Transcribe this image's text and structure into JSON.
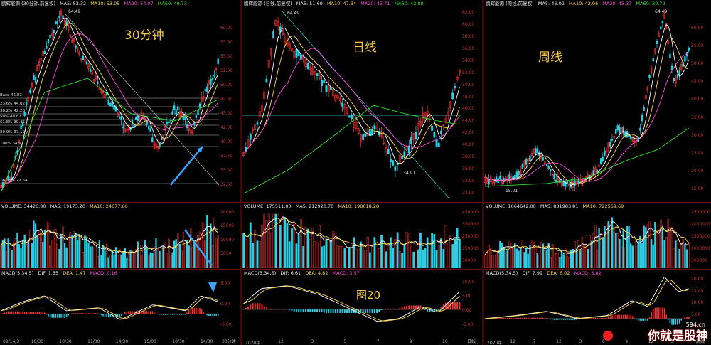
{
  "panels": [
    {
      "id": "p1",
      "title": "鹏辉能源 (30分钟,前复权)",
      "period_label": "30分钟",
      "ma": {
        "ma5": "MA5: 53.32",
        "ma10": "MA10: 53.05",
        "ma20": "MA20: 54.07",
        "ma60": "MA60: 49.73"
      },
      "high_label": "64.49",
      "price_axis": [
        "60.00",
        "57.50",
        "55.00",
        "52.50",
        "50.00",
        "47.50",
        "45.00",
        "42.50",
        "40.00",
        "37.50",
        "35.00",
        "32.50"
      ],
      "fib": [
        "Base 46.83",
        "23.6% 44.02",
        "38.2% 42.28",
        "50% 40.87",
        "61.8% 39.46",
        "80.9% 37.19",
        "100% 34.91",
        "161.8% 27.54"
      ],
      "volume": {
        "label": "VOLUME: 34426.00",
        "ma5": "MA5: 19173.20",
        "ma10": "MA10: 24677.60"
      },
      "vol_axis": [
        "20000",
        "15000",
        "10000",
        "5000"
      ],
      "macd": {
        "label": "MACD(5,34,5)",
        "dif": "DIF: 1.55",
        "dea": "DEA: 1.47",
        "macd": "MACD: 0.16"
      },
      "macd_axis": [
        "5.00",
        "0.00",
        "-5.00"
      ],
      "x_labels": [
        "09/14/3",
        "10/30",
        "10/30",
        "11/30",
        "14/30",
        "15/00",
        "10/30",
        "14/30"
      ],
      "footer": "30分钟"
    },
    {
      "id": "p2",
      "title": "鹏辉能源 (日线,前复权)",
      "period_label": "日线",
      "ma": {
        "ma5": "MA5: 51.69",
        "ma10": "MA10: 47.34",
        "ma20": "MA20: 45.71",
        "ma60": "MA60: 43.88"
      },
      "high_label": "64.49",
      "low_label": "34.91",
      "price_axis": [
        "62.00",
        "60.00",
        "58.00",
        "56.00",
        "54.00",
        "52.00",
        "50.00",
        "48.00",
        "46.00",
        "44.00",
        "42.00",
        "40.00",
        "38.00",
        "36.00",
        "34.00",
        "32.00"
      ],
      "volume": {
        "label": "VOLUME: 175511.00",
        "ma5": "MA5: 212928.78",
        "ma10": "MA10: 198018.28"
      },
      "vol_axis": [
        "450000",
        "350000",
        "250000",
        "150000",
        "50000"
      ],
      "macd": {
        "label": "MACD(5,34,5)",
        "dif": "DIF: 6.61",
        "dea": "DEA: 4.82",
        "macd": "MACD: 3.57"
      },
      "macd_axis": [
        "10.00",
        "5.00",
        "0.00",
        "-5.00"
      ],
      "annotation": "图20",
      "x_labels": [
        "2020年",
        "12",
        "3",
        "5",
        "7",
        "9",
        "10"
      ],
      "footer": "日线"
    },
    {
      "id": "p3",
      "title": "鹏辉能源 (周线,前复权)",
      "period_label": "周线",
      "ma": {
        "ma5": "MA5: 46.02",
        "ma10": "MA10: 42.96",
        "ma20": "MA20: 45.37",
        "ma60": "MA60: 30.72"
      },
      "high_label": "64.49",
      "low_label": "15.01",
      "price_axis": [
        "60.00",
        "55.00",
        "50.00",
        "45.00",
        "40.00",
        "35.00",
        "30.00",
        "25.00",
        "20.00",
        "15.00"
      ],
      "volume": {
        "label": "VOLUME: 1064642.00",
        "ma5": "MA5: 831983.81",
        "ma10": "MA10: 722569.69"
      },
      "vol_axis": [
        "2500000",
        "2000000",
        "1500000",
        "1000000",
        "500000"
      ],
      "macd": {
        "label": "MACD(5,34,5)",
        "dif": "DIF: 7.99",
        "dea": "DEA: 6.02",
        "macd": "MACD: 3.82"
      },
      "macd_axis": [
        "20.00",
        "15.00",
        "10.00",
        "5.00",
        "0.00"
      ],
      "x_labels": [
        "2020年",
        "12",
        "7",
        "12",
        "3",
        "6",
        "9",
        "12",
        "3"
      ],
      "footer": "周线"
    }
  ],
  "watermark": {
    "text": "你就是股神",
    "url": "594.cn"
  },
  "colors": {
    "up": "#ff3030",
    "down": "#27d3e8",
    "ma5": "#ffffff",
    "ma10": "#ffd84a",
    "ma20": "#ff4bd8",
    "ma60": "#33dd33",
    "arrow": "#3ca4ff"
  }
}
